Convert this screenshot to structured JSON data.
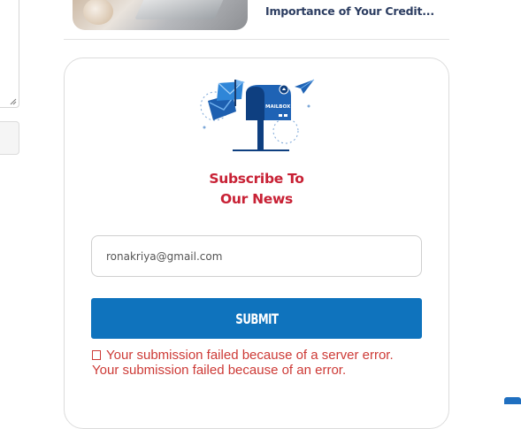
{
  "related_post": {
    "title": "Importance of Your Credit..."
  },
  "newsletter": {
    "illustration_label": "MAILBOX",
    "heading_line1": "Subscribe To",
    "heading_line2": "Our News",
    "email_value": "ronakriya@gmail.com",
    "submit_label": "SUBMIT",
    "errors": [
      "Your submission failed because of a server error.",
      "Your submission failed because of an error."
    ],
    "error_color": "#cd3a36",
    "accent_color": "#c82135",
    "button_color": "#0f73bd"
  }
}
